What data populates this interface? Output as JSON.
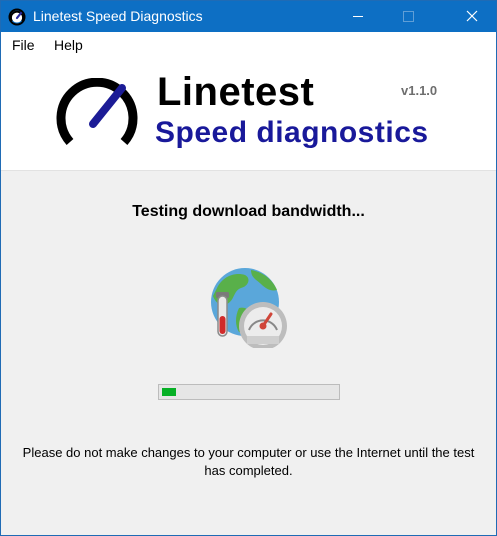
{
  "window": {
    "title": "Linetest Speed Diagnostics",
    "controls": [
      "minimize-icon",
      "maximize-icon",
      "close-icon"
    ]
  },
  "menu": {
    "file": "File",
    "help": "Help"
  },
  "header": {
    "title": "Linetest",
    "subtitle": "Speed diagnostics",
    "version": "v1.1.0"
  },
  "main": {
    "status": "Testing download bandwidth...",
    "illustration_icon": "globe-speedometer-icon",
    "progress_fraction": 0.08,
    "notice": "Please do not make changes to your computer or use the Internet until the test has completed."
  },
  "colors": {
    "titlebar": "#0d6fc4",
    "subtitle": "#19199a",
    "progress": "#06b025"
  }
}
